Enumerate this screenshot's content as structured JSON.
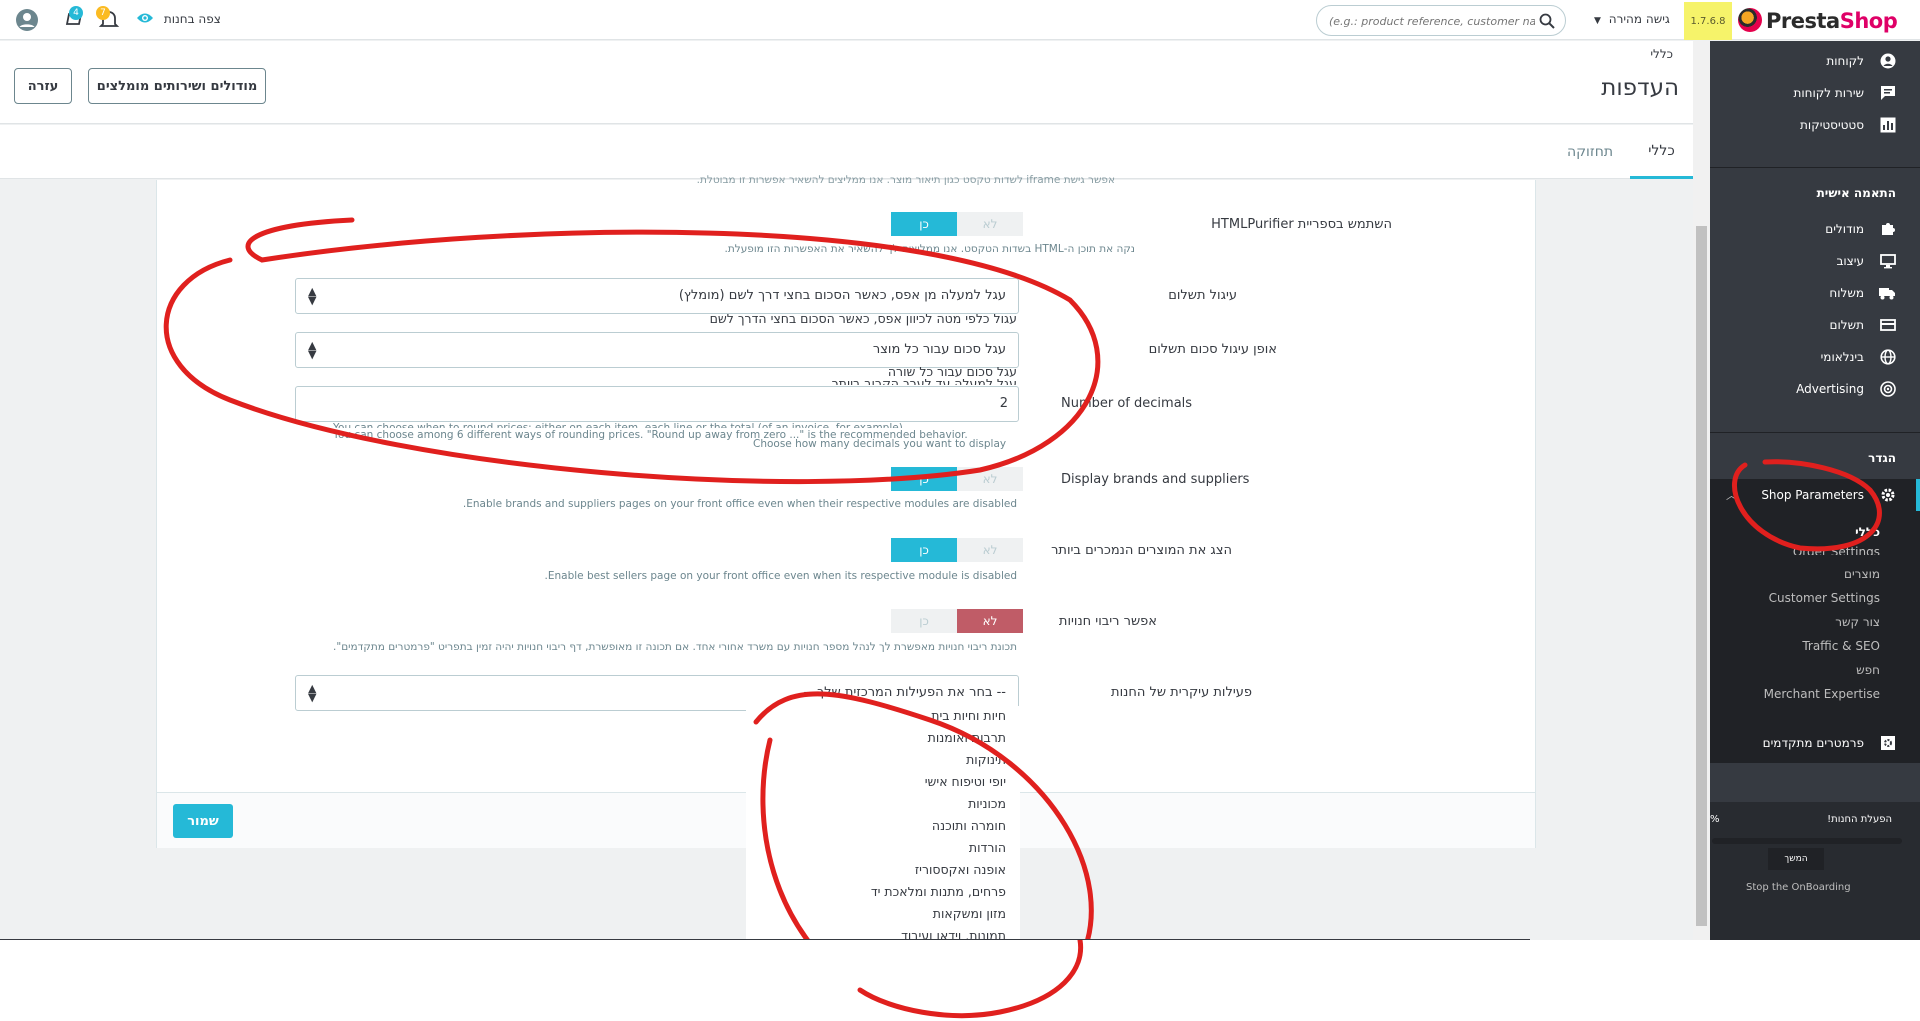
{
  "topbar": {
    "version": "1.7.6.8",
    "logo_presta": "Presta",
    "logo_shop": "Shop",
    "quick_access": "גישה מהירה",
    "search_placeholder": "(e.g.: product reference, customer name",
    "view_shop": "צפה בחנות",
    "orders_badge": "4",
    "notif_badge": "7"
  },
  "header": {
    "breadcrumb": "כללי",
    "title": "העדפות",
    "help_button": "עזרה",
    "modules_button": "מודולים ושירותים מומלצים"
  },
  "tabs": [
    {
      "label": "כללי",
      "active": true
    },
    {
      "label": "תחזוקה",
      "active": false
    }
  ],
  "form": {
    "top_cut_text": "אפשר גישת iframe לשדות טקסט כגון תיאור מוצר. אנו ממליצים להשאיר אפשרות זו מבוטלת.",
    "htmlpurifier": {
      "label": "השתמש בספריית HTMLPurifier",
      "no": "לא",
      "yes": "כן",
      "help": "נקה את תוכן ה-HTML בשדות הטקסט. אנו ממליצים לך להשאיר את האפשרות הזו מופעלת."
    },
    "round_mode": {
      "label": "עיגול תשלום",
      "value": "עגל למעלה מן אפס, כאשר הסכום בחצי דרך לשם (מומלץ)",
      "option_below": "עגול כלפי מטה לכיוון אפס, כאשר הסכום בחצי הדרך לשם"
    },
    "round_type": {
      "label": "אופן עיגול סכום תשלום",
      "value": "עגל סכום עבור כל מוצר",
      "option_1": "עגל סכום עבור כל שורה",
      "option_2": "עגל למעלה עד לערך הקרוב ביותר"
    },
    "decimals": {
      "label": "Number of decimals",
      "value": "2",
      "help_1": "You can choose when to round prices: either on each item, each line or the total (of an invoice, for example).",
      "help_2": "You can choose among 6 different ways of rounding prices. \"Round up away from zero ...\" is the recommended behavior.",
      "help_3": "Choose how many decimals you want to display"
    },
    "brands": {
      "label": "Display brands and suppliers",
      "no": "לא",
      "yes": "כן",
      "help": "Enable brands and suppliers pages on your front office even when their respective modules are disabled."
    },
    "bestsellers": {
      "label": "הצג את המוצרים הנמכרים ביותר",
      "no": "לא",
      "yes": "כן",
      "help": "Enable best sellers page on your front office even when its respective module is disabled."
    },
    "multistore": {
      "label": "אפשר ריבוי חנויות",
      "no": "לא",
      "yes": "כן",
      "help": "תכונת ריבוי חנויות מאפשרת לך לנהל מספר חנויות עם משרד אחורי אחד. אם תכונה זו מאופשרת, דף ריבוי חנויות יהיה זמין בתפריט \"פרמטרים מתקדמים\"."
    },
    "activity": {
      "label": "פעילות עיקרית של החנות",
      "value": "-- בחר את הפעילות המרכזית שלך --"
    },
    "save": "שמור"
  },
  "activity_options": [
    "חיות וחיות בית",
    "תרבות ואומנות",
    "תינוקות",
    "יופי וטיפוח אישי",
    "מכוניות",
    "חומרה ותוכנה",
    "הורדות",
    "אופנה ואקססוריז",
    "פרחים, מתנות ומלאכת יד",
    "מזון ומשקאות",
    "תמונות, וידאו ועיבוד"
  ],
  "sidebar": {
    "items_top": [
      "לקוחות",
      "שירות לקוחות",
      "סטטיסטיקות"
    ],
    "section_customize": "התאמה אישית",
    "items_customize": [
      "מודולים",
      "עיצוב",
      "משלוח",
      "תשלום",
      "בינלאומי",
      "Advertising"
    ],
    "section_configure": "הגדר",
    "shop_parameters": "Shop Parameters",
    "sub_items": [
      "כללי",
      "Order Settings",
      "מוצרים",
      "Customer Settings",
      "צור קשר",
      "Traffic & SEO",
      "חפש",
      "Merchant Expertise"
    ],
    "advanced": "פרמטרים מתקדמים",
    "onboarding_label": "הפעלת החנות!",
    "onboarding_percent": "%",
    "continue_btn": "המשך",
    "stop_onboarding": "Stop the OnBoarding"
  },
  "colors": {
    "accent": "#25b9d7",
    "danger_toggle": "#c05c67",
    "sidebar": "#363a41",
    "annotation": "#e0201e"
  }
}
